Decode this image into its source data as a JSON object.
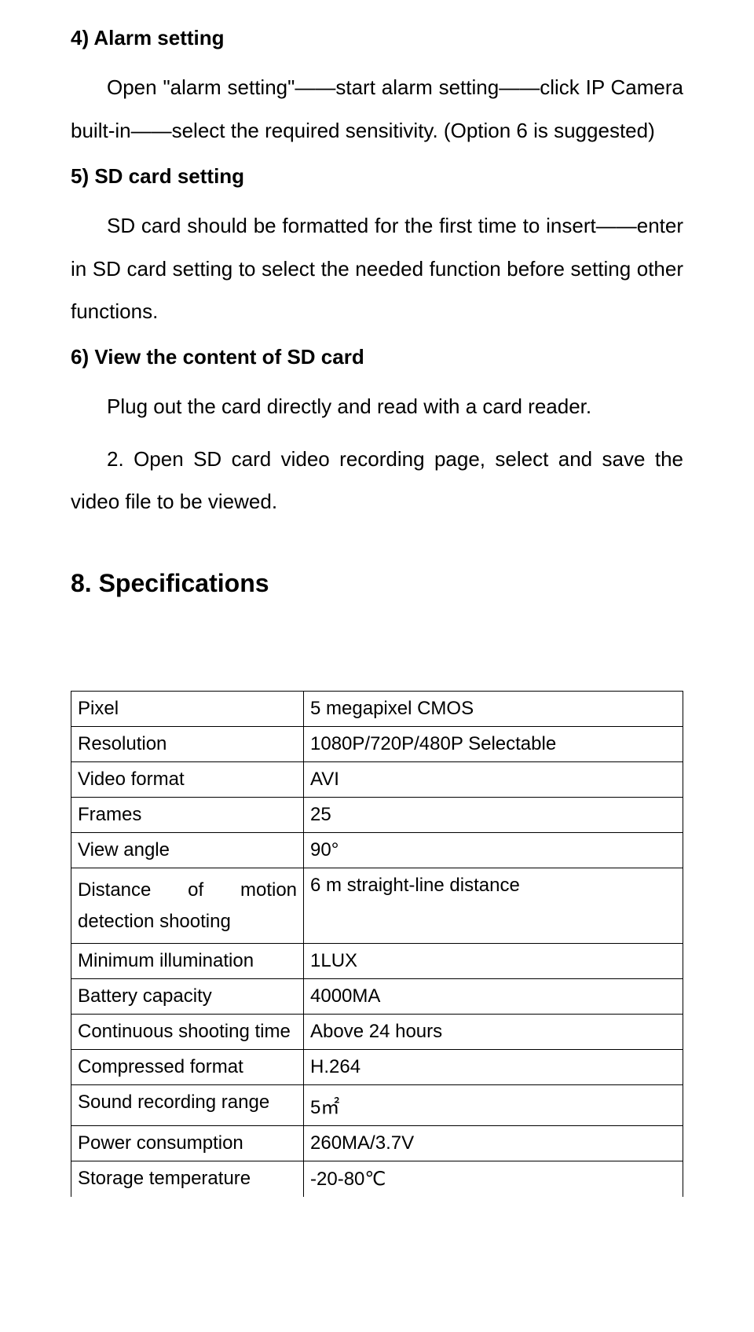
{
  "section4": {
    "heading": "4) Alarm setting",
    "p1": "Open \"alarm setting\"——start alarm setting——click IP Camera built-in——select the required sensitivity. (Option 6 is suggested)"
  },
  "section5": {
    "heading": "5) SD card setting",
    "p1": "SD card should be formatted for the first time to insert——enter in SD card setting to select the needed function before setting other functions."
  },
  "section6": {
    "heading": "6) View the content of SD card",
    "p1": "Plug out the card directly and read with a card reader.",
    "p2": "2. Open SD card video recording page, select and save the video file to be viewed."
  },
  "specifications": {
    "heading": "8. Specifications",
    "rows": [
      {
        "label": "Pixel",
        "value": "5 megapixel CMOS"
      },
      {
        "label": "Resolution",
        "value": "1080P/720P/480P Selectable"
      },
      {
        "label": "Video format",
        "value": "AVI"
      },
      {
        "label": "Frames",
        "value": "25"
      },
      {
        "label": "View angle",
        "value": "90°"
      },
      {
        "label": "Distance of motion detection shooting",
        "value": "6 m straight-line distance"
      },
      {
        "label": "Minimum illumination",
        "value": "1LUX"
      },
      {
        "label": "Battery capacity",
        "value": "4000MA"
      },
      {
        "label": "Continuous shooting time",
        "value": "Above 24 hours"
      },
      {
        "label": "Compressed format",
        "value": "H.264"
      },
      {
        "label": "Sound recording range",
        "value": "5㎡"
      },
      {
        "label": "Power consumption",
        "value": "260MA/3.7V"
      },
      {
        "label": "Storage temperature",
        "value": "-20-80℃"
      }
    ]
  }
}
